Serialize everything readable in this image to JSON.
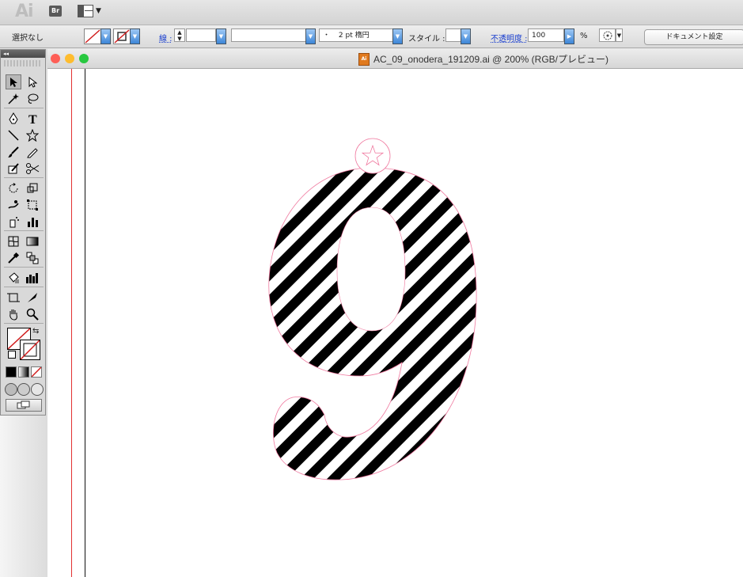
{
  "app": {
    "logo_text": "Ai",
    "bridge_label": "Br"
  },
  "control_bar": {
    "selection_label": "選択なし",
    "stroke_label": "線 :",
    "stroke_profile": "2 pt 楕円",
    "stroke_profile_prefix": "・",
    "style_label": "スタイル :",
    "opacity_label": "不透明度 :",
    "opacity_value": "100",
    "opacity_unit": "%",
    "document_setup_button": "ドキュメント設定"
  },
  "document": {
    "title": "AC_09_onodera_191209.ai @ 200% (RGB/プレビュー)",
    "icon_text": "Ai"
  },
  "colors": {
    "guide_red": "#e23030",
    "stripe": "#000000",
    "outline": "#f07aa0",
    "close": "#fe5f57",
    "minimize": "#febc2e",
    "zoom": "#28c840"
  },
  "tools": [
    "selection-tool",
    "direct-selection-tool",
    "magic-wand-tool",
    "lasso-tool",
    "pen-tool",
    "type-tool",
    "line-tool",
    "star-tool",
    "paintbrush-tool",
    "pencil-tool",
    "blob-brush-tool",
    "scissors-tool",
    "rotate-tool",
    "scale-tool",
    "warp-tool",
    "free-transform-tool",
    "symbol-sprayer-tool",
    "column-graph-tool",
    "mesh-tool",
    "gradient-tool",
    "eyedropper-tool",
    "blend-tool",
    "live-paint-tool",
    "bar-graph-tool",
    "artboard-tool",
    "slice-tool",
    "hand-tool",
    "zoom-tool"
  ]
}
